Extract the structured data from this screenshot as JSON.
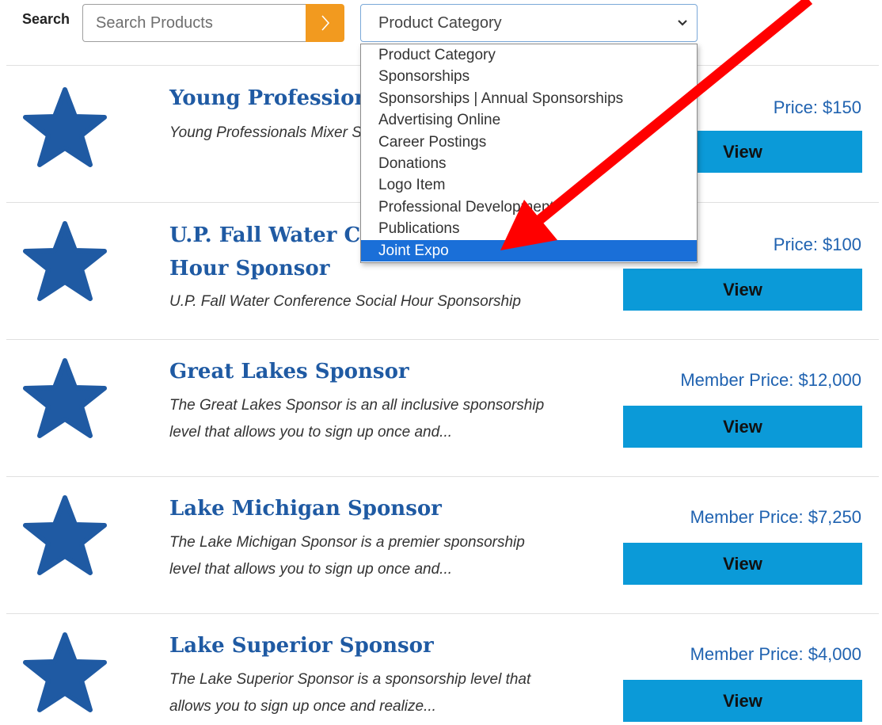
{
  "search": {
    "label": "Search",
    "placeholder": "Search Products",
    "value": ""
  },
  "category_select": {
    "selected": "Product Category",
    "options": [
      "Product Category",
      "Sponsorships",
      "Sponsorships | Annual Sponsorships",
      "Advertising Online",
      "Career Postings",
      "Donations",
      "Logo Item",
      "Professional Development",
      "Publications",
      "Joint Expo"
    ],
    "highlighted": "Joint Expo"
  },
  "products": [
    {
      "title_lines": [
        "Young Professionals Mixer",
        ""
      ],
      "description_lines": [
        "Young Professionals Mixer Sponsorship",
        ""
      ],
      "price": "Price: $150",
      "button": "View"
    },
    {
      "title_lines": [
        "U.P. Fall Water Conference Social",
        "Hour Sponsor"
      ],
      "description_lines": [
        "U.P. Fall Water Conference Social Hour Sponsorship",
        ""
      ],
      "price": "Price: $100",
      "button": "View"
    },
    {
      "title_lines": [
        "Great Lakes Sponsor",
        ""
      ],
      "description_lines": [
        "The Great Lakes Sponsor is an all inclusive sponsorship",
        "level that allows you to sign up once and..."
      ],
      "price": "Member Price: $12,000",
      "button": "View"
    },
    {
      "title_lines": [
        "Lake Michigan Sponsor",
        ""
      ],
      "description_lines": [
        "The Lake Michigan Sponsor is a premier sponsorship",
        "level that allows you to sign up once and..."
      ],
      "price": "Member Price: $7,250",
      "button": "View"
    },
    {
      "title_lines": [
        "Lake Superior Sponsor",
        ""
      ],
      "description_lines": [
        "The Lake Superior Sponsor is a sponsorship level that",
        "allows you to sign up once and realize..."
      ],
      "price": "Member Price: $4,000",
      "button": "View"
    }
  ],
  "icons": {
    "product": "star-icon",
    "search_button": "chevron-right-icon",
    "select": "chevron-down-icon",
    "annotation": "red-arrow-annotation"
  },
  "colors": {
    "title": "#1f5aa3",
    "star": "#1f5aa3",
    "price": "#1f62b0",
    "view_button": "#0b9ad8",
    "search_button": "#f29a1f",
    "option_highlight": "#1a6fd8",
    "arrow": "#ff0000"
  }
}
